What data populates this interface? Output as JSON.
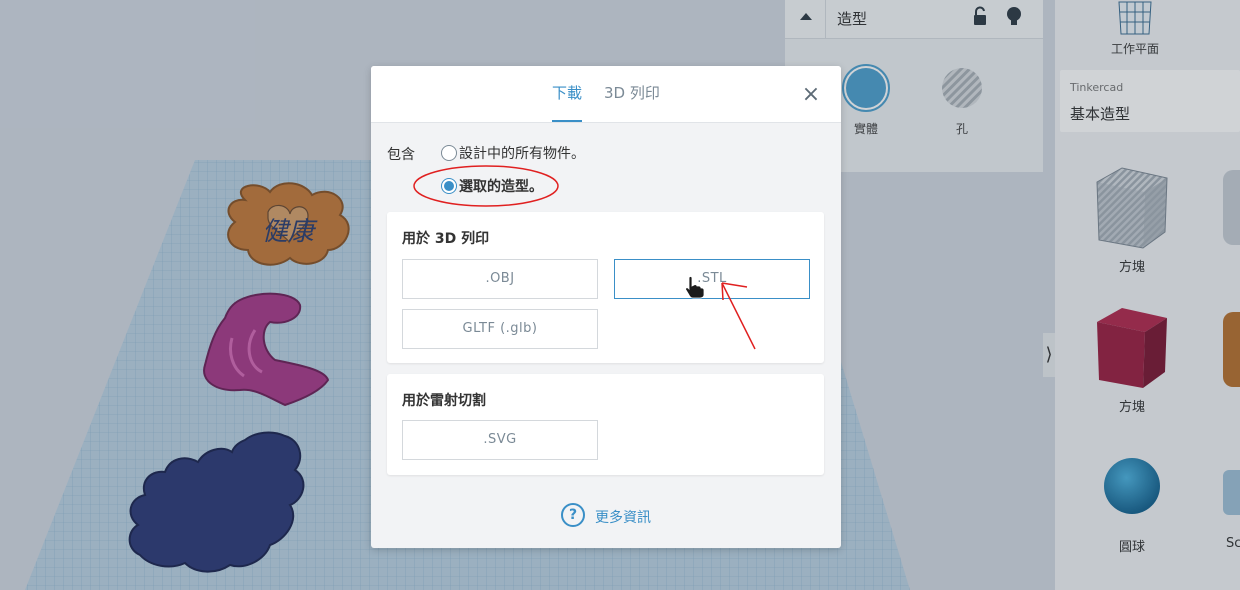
{
  "workspace": {
    "objects": [
      "keychain-health",
      "keychain-pink",
      "dragon-silhouette"
    ],
    "keychain_text": "健康"
  },
  "inspector": {
    "title": "造型",
    "options": [
      {
        "label": "實體",
        "icon": "solid-icon"
      },
      {
        "label": "孔",
        "icon": "hole-icon"
      }
    ]
  },
  "right_panel": {
    "workplane_label": "工作平面",
    "library_brand": "Tinkercad",
    "library_name": "基本造型",
    "shapes": [
      {
        "label": "方塊",
        "icon": "box-striped-icon"
      },
      {
        "label": "方塊",
        "icon": "box-red-icon"
      },
      {
        "label": "圓球",
        "icon": "sphere-icon"
      },
      {
        "label": "Sc",
        "icon": "scribble-icon"
      }
    ]
  },
  "modal": {
    "tabs": [
      {
        "label": "下載",
        "active": true
      },
      {
        "label": "3D 列印",
        "active": false
      }
    ],
    "close_symbol": "×",
    "include_label": "包含",
    "radio_options": [
      {
        "label": "設計中的所有物件。",
        "checked": false
      },
      {
        "label": "選取的造型。",
        "checked": true
      }
    ],
    "print_section": {
      "title": "用於 3D 列印",
      "buttons": [
        ".OBJ",
        ".STL",
        "GLTF (.glb)"
      ]
    },
    "laser_section": {
      "title": "用於雷射切割",
      "buttons": [
        ".SVG"
      ]
    },
    "more_info": {
      "icon_glyph": "?",
      "label": "更多資訊"
    }
  },
  "colors": {
    "accent": "#3a8fc7",
    "annotation_red": "#e02020"
  }
}
